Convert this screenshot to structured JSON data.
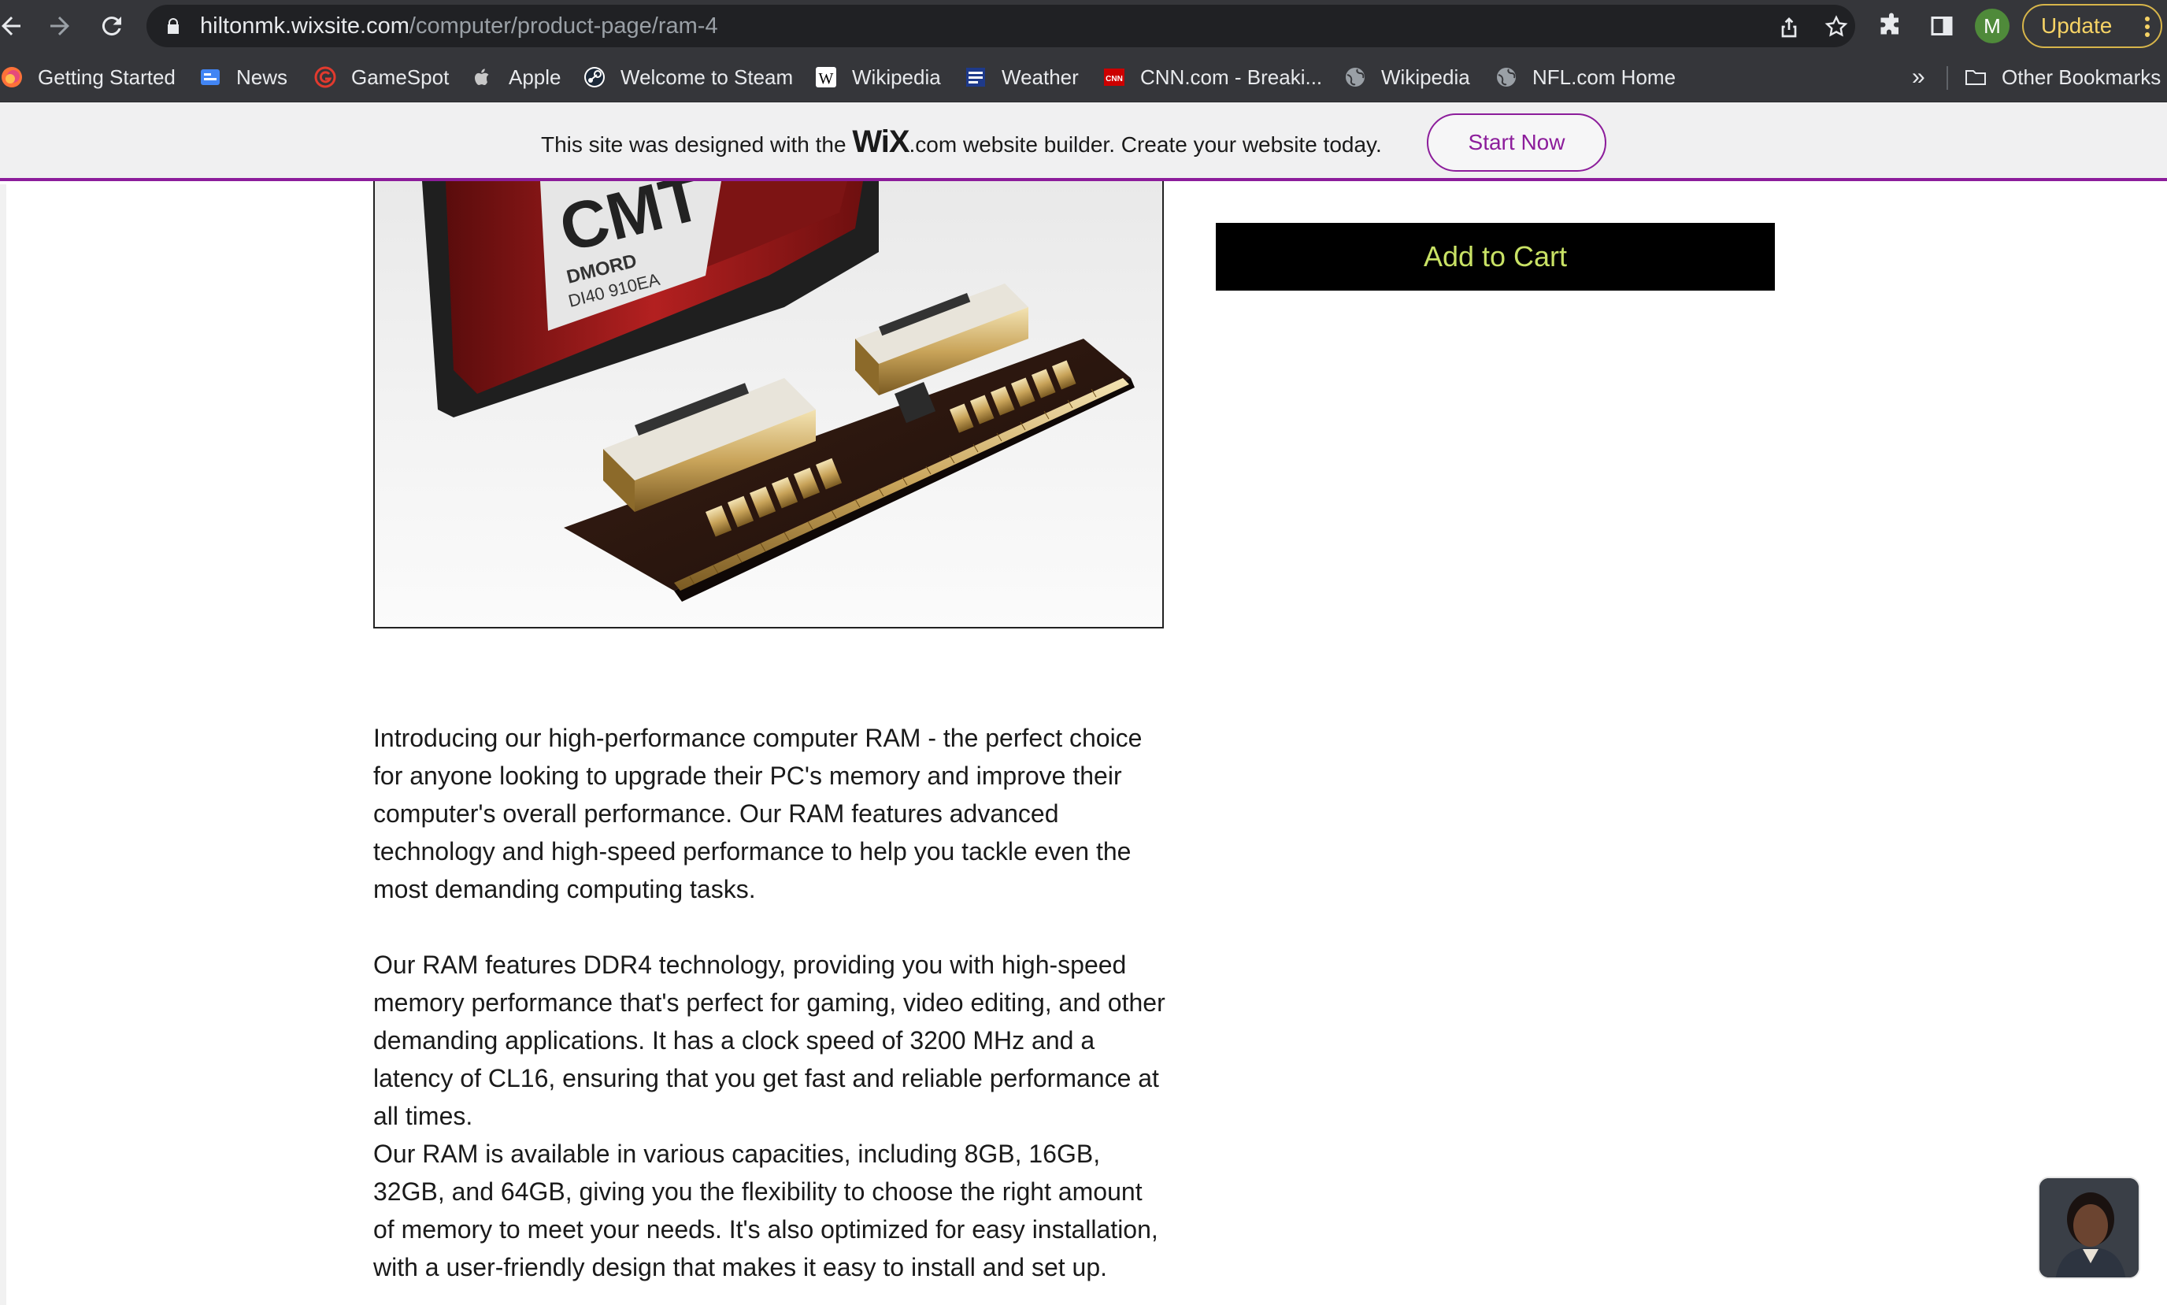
{
  "browser": {
    "url_host": "hiltonmk.wixsite.com",
    "url_path": "/computer/product-page/ram-4",
    "profile_initial": "M",
    "update_label": "Update",
    "icons": [
      "back-icon",
      "forward-icon",
      "reload-icon",
      "lock-icon",
      "share-icon",
      "star-icon",
      "extensions-icon",
      "side-panel-icon",
      "more-vert-icon"
    ]
  },
  "bookmarks": {
    "items": [
      {
        "label": "Getting Started",
        "icon": "firefox-icon"
      },
      {
        "label": "News",
        "icon": "google-news-icon"
      },
      {
        "label": "GameSpot",
        "icon": "gamespot-icon"
      },
      {
        "label": "Apple",
        "icon": "apple-icon"
      },
      {
        "label": "Welcome to Steam",
        "icon": "steam-icon"
      },
      {
        "label": "Wikipedia",
        "icon": "wikipedia-icon"
      },
      {
        "label": "Weather",
        "icon": "weather-channel-icon"
      },
      {
        "label": "CNN.com - Breaki...",
        "icon": "cnn-icon"
      },
      {
        "label": "Wikipedia",
        "icon": "globe-icon"
      },
      {
        "label": "NFL.com Home",
        "icon": "globe-icon"
      }
    ],
    "overflow_label": "»",
    "other_label": "Other Bookmarks"
  },
  "wix_banner": {
    "text_before": "This site was designed with the ",
    "logo": "WiX",
    "text_after": ".com website builder. Create your website today.",
    "cta": "Start Now"
  },
  "product": {
    "add_to_cart": "Add to Cart",
    "image_labels": [
      "CMT",
      "DMORD",
      "DI40 910EA"
    ],
    "description": [
      "Introducing our high-performance computer RAM - the perfect choice for anyone looking to upgrade their PC's memory and improve their computer's overall performance. Our RAM features advanced technology and high-speed performance to help you tackle even the most demanding computing tasks.",
      "Our RAM features DDR4 technology, providing you with high-speed memory performance that's perfect for gaming, video editing, and other demanding applications. It has a clock speed of 3200 MHz and a latency of CL16, ensuring that you get fast and reliable performance at all times.",
      "Our RAM is available in various capacities, including 8GB, 16GB, 32GB, and 64GB, giving you the flexibility to choose the right amount of memory to meet your needs. It's also optimized for easy installation, with a user-friendly design that makes it easy to install and set up."
    ]
  },
  "colors": {
    "toolbar_bg": "#35363a",
    "wix_accent": "#8c1d9b",
    "cart_text": "#c9e265",
    "cart_bg": "#000000"
  }
}
